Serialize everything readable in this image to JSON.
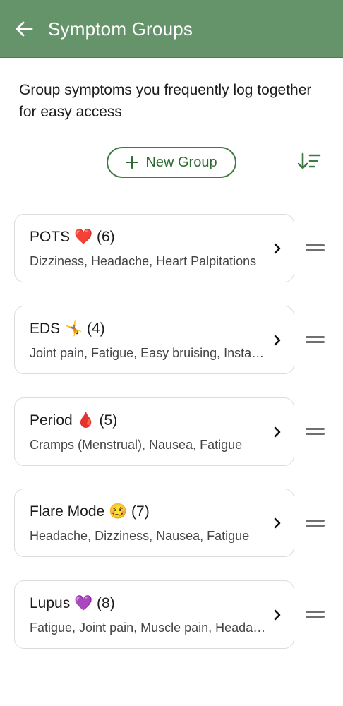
{
  "appbar": {
    "title": "Symptom Groups",
    "back_icon": "arrow-left-icon",
    "color": "#66946a"
  },
  "description": "Group symptoms you frequently log together for easy access",
  "actions": {
    "new_group_label": "New Group",
    "new_group_icon": "plus-icon",
    "sort_icon": "sort-descending-icon",
    "accent": "#2f6a35"
  },
  "groups": [
    {
      "title": "POTS ❤️ (6)",
      "symptoms": "Dizziness, Headache, Heart Palpitations"
    },
    {
      "title": "EDS 🤸 (4)",
      "symptoms": "Joint pain, Fatigue, Easy bruising, Instability"
    },
    {
      "title": "Period 🩸 (5)",
      "symptoms": "Cramps (Menstrual), Nausea, Fatigue"
    },
    {
      "title": "Flare Mode 🥴 (7)",
      "symptoms": "Headache, Dizziness, Nausea, Fatigue"
    },
    {
      "title": "Lupus 💜 (8)",
      "symptoms": "Fatigue, Joint pain, Muscle pain, Headache"
    }
  ]
}
